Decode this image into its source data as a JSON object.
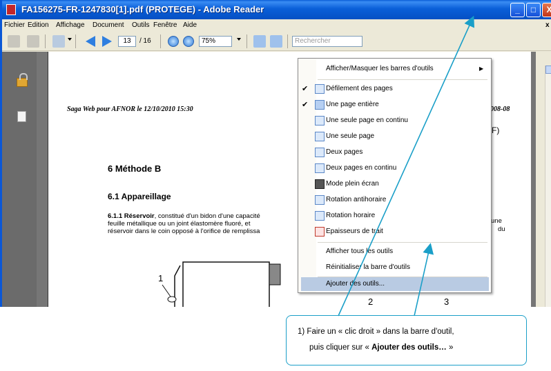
{
  "window": {
    "title": "FA156275-FR-1247830[1].pdf (PROTEGE) - Adobe Reader",
    "min_label": "_",
    "max_label": "□",
    "close_label": "X"
  },
  "menubar": {
    "items": [
      "Fichier",
      "Edition",
      "Affichage",
      "Document",
      "Outils",
      "Fenêtre",
      "Aide"
    ],
    "close_label": "x"
  },
  "toolbar": {
    "page_current": "13",
    "page_total": "/ 16",
    "zoom": "75%",
    "search_placeholder": "Rechercher"
  },
  "document": {
    "header_left": "Saga Web pour AFNOR le 12/10/2010 15:30",
    "header_right": "008-08",
    "lang": "(F)",
    "section_title": "6   Méthode B",
    "subsection_title": "6.1   Appareillage",
    "para_num": "6.1.1",
    "para_term": "Réservoir",
    "para_line1_rest": ", constitué d'un bidon d'une capacité",
    "para_line2": "feuille métallique ou un joint élastomère fluoré, et",
    "para_line3": "réservoir dans le coin opposé à l'orifice de remplissa",
    "para_right1": "une",
    "para_right2": "du",
    "fig_label_1": "1",
    "fig_label_2": "2",
    "fig_label_3": "3"
  },
  "context_menu": {
    "items": [
      {
        "label": "Afficher/Masquer les barres d'outils",
        "checked": false,
        "submenu": true,
        "icon": ""
      },
      {
        "label": "Défilement des pages",
        "checked": true,
        "icon": "scroll-pages-icon"
      },
      {
        "label": "Une page entière",
        "checked": true,
        "icon": "fit-page-icon"
      },
      {
        "label": "Une seule page en continu",
        "checked": false,
        "icon": "single-continuous-icon"
      },
      {
        "label": "Une seule page",
        "checked": false,
        "icon": "single-page-icon"
      },
      {
        "label": "Deux pages",
        "checked": false,
        "icon": "two-pages-icon"
      },
      {
        "label": "Deux pages en continu",
        "checked": false,
        "icon": "two-continuous-icon"
      },
      {
        "label": "Mode plein écran",
        "checked": false,
        "icon": "fullscreen-icon"
      },
      {
        "label": "Rotation antihoraire",
        "checked": false,
        "icon": "rotate-ccw-icon"
      },
      {
        "label": "Rotation horaire",
        "checked": false,
        "icon": "rotate-cw-icon"
      },
      {
        "label": "Epaisseurs de trait",
        "checked": false,
        "icon": "line-weights-icon"
      },
      {
        "label": "Afficher tous les outils",
        "checked": false,
        "icon": ""
      },
      {
        "label": "Réinitialiser la barre d'outils",
        "checked": false,
        "icon": ""
      },
      {
        "label": "Ajouter des outils...",
        "checked": false,
        "icon": "",
        "highlighted": true
      }
    ],
    "check_glyph": "✔",
    "submenu_glyph": "▶"
  },
  "callout": {
    "line1": "1)  Faire un « clic droit » dans la barre d'outil,",
    "line2_prefix": "puis cliquer sur « ",
    "line2_bold": "Ajouter des outils…",
    "line2_suffix": " »"
  },
  "colors": {
    "titlebar": "#0a5fd8",
    "callout_border": "#1a9fc8",
    "menu_highlight": "#b9cbe3"
  }
}
